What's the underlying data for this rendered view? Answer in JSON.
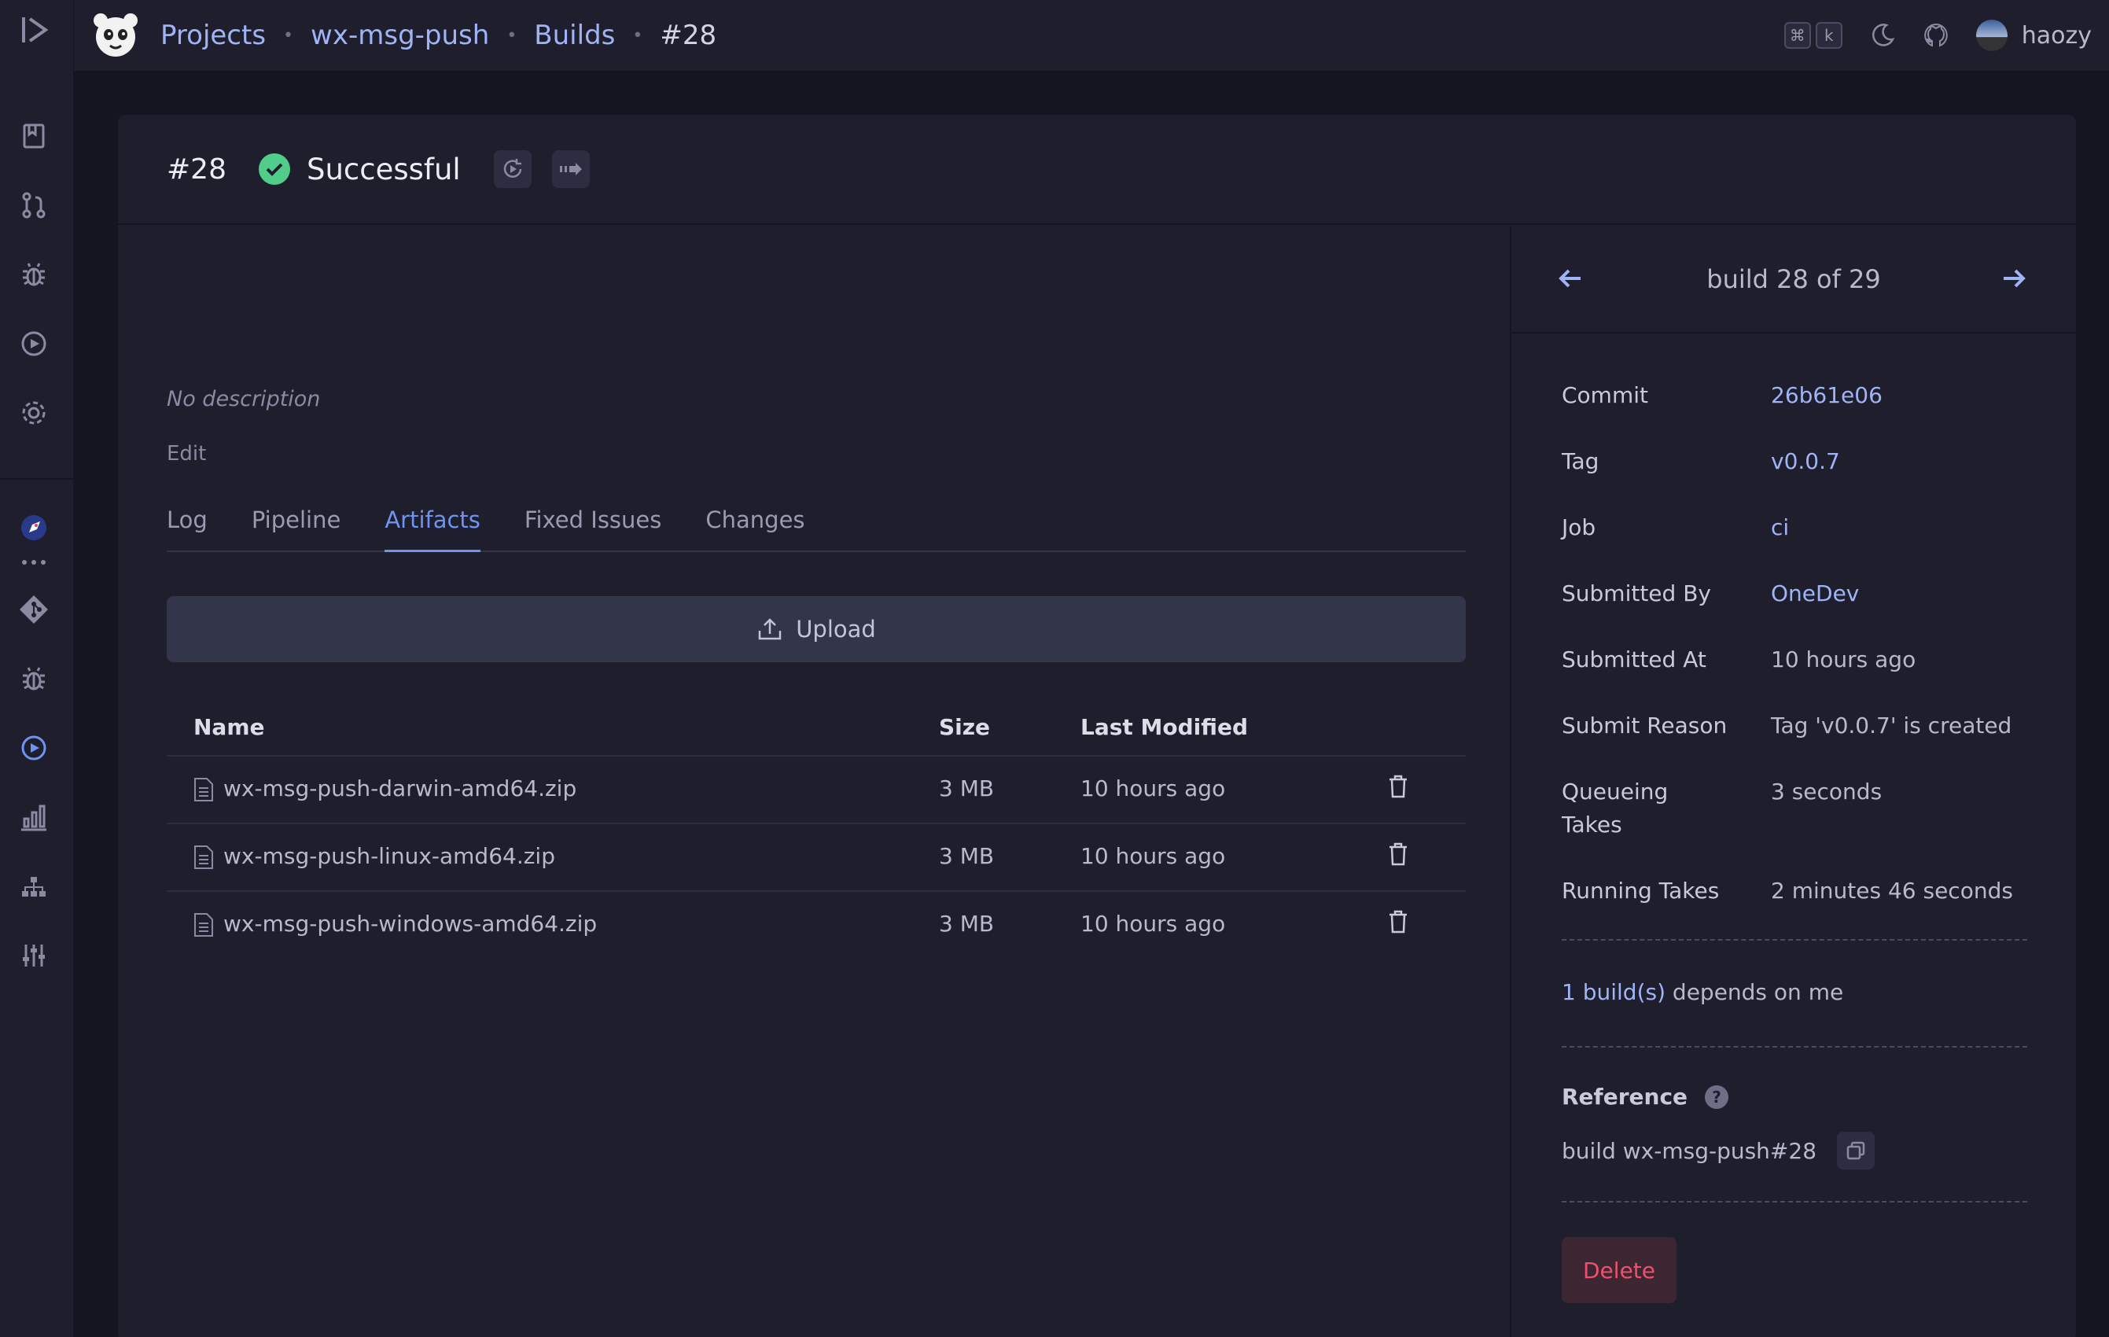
{
  "topbar": {
    "breadcrumbs": [
      "Projects",
      "wx-msg-push",
      "Builds"
    ],
    "current": "#28",
    "kbd_cmd": "⌘",
    "kbd_k": "k",
    "user": "haozy"
  },
  "build": {
    "number": "#28",
    "status": "Successful",
    "status_color": "#50cd89",
    "description": "No description",
    "edit_label": "Edit"
  },
  "tabs": [
    {
      "label": "Log"
    },
    {
      "label": "Pipeline"
    },
    {
      "label": "Artifacts"
    },
    {
      "label": "Fixed Issues"
    },
    {
      "label": "Changes"
    }
  ],
  "artifacts": {
    "upload_label": "Upload",
    "columns": [
      "Name",
      "Size",
      "Last Modified"
    ],
    "rows": [
      {
        "name": "wx-msg-push-darwin-amd64.zip",
        "size": "3 MB",
        "modified": "10 hours ago"
      },
      {
        "name": "wx-msg-push-linux-amd64.zip",
        "size": "3 MB",
        "modified": "10 hours ago"
      },
      {
        "name": "wx-msg-push-windows-amd64.zip",
        "size": "3 MB",
        "modified": "10 hours ago"
      }
    ]
  },
  "side": {
    "nav_label": "build 28 of 29",
    "props": [
      {
        "key": "Commit",
        "value": "26b61e06",
        "link": true
      },
      {
        "key": "Tag",
        "value": "v0.0.7",
        "link": true
      },
      {
        "key": "Job",
        "value": "ci",
        "link": true
      },
      {
        "key": "Submitted By",
        "value": "OneDev",
        "link": true
      },
      {
        "key": "Submitted At",
        "value": "10 hours ago",
        "link": false
      },
      {
        "key": "Submit Reason",
        "value": "Tag 'v0.0.7' is created",
        "link": false
      },
      {
        "key": "Queueing Takes",
        "value": "3 seconds",
        "link": false
      },
      {
        "key": "Running Takes",
        "value": "2 minutes 46 seconds",
        "link": false
      }
    ],
    "depends_link": "1 build(s)",
    "depends_text": " depends on me",
    "reference_title": "Reference",
    "reference_value": "build wx-msg-push#28",
    "delete_label": "Delete"
  }
}
